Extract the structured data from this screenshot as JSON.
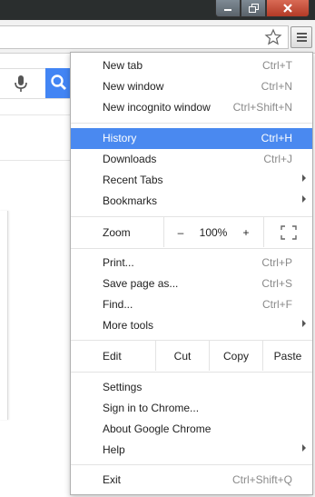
{
  "menu": {
    "items_top": [
      {
        "label": "New tab",
        "shortcut": "Ctrl+T"
      },
      {
        "label": "New window",
        "shortcut": "Ctrl+N"
      },
      {
        "label": "New incognito window",
        "shortcut": "Ctrl+Shift+N"
      }
    ],
    "items_mid": [
      {
        "label": "History",
        "shortcut": "Ctrl+H",
        "highlighted": true
      },
      {
        "label": "Downloads",
        "shortcut": "Ctrl+J"
      },
      {
        "label": "Recent Tabs",
        "submenu": true
      },
      {
        "label": "Bookmarks",
        "submenu": true
      }
    ],
    "zoom": {
      "label": "Zoom",
      "minus": "–",
      "value": "100%",
      "plus": "+"
    },
    "items_tools": [
      {
        "label": "Print...",
        "shortcut": "Ctrl+P"
      },
      {
        "label": "Save page as...",
        "shortcut": "Ctrl+S"
      },
      {
        "label": "Find...",
        "shortcut": "Ctrl+F"
      },
      {
        "label": "More tools",
        "submenu": true
      }
    ],
    "edit": {
      "label": "Edit",
      "cut": "Cut",
      "copy": "Copy",
      "paste": "Paste"
    },
    "items_settings": [
      {
        "label": "Settings"
      },
      {
        "label": "Sign in to Chrome..."
      },
      {
        "label": "About Google Chrome"
      },
      {
        "label": "Help",
        "submenu": true
      }
    ],
    "exit": {
      "label": "Exit",
      "shortcut": "Ctrl+Shift+Q"
    }
  },
  "colors": {
    "highlight": "#4a89f0",
    "search_button": "#4285f4",
    "close_button": "#c7432d"
  },
  "icons": [
    "minimize-icon",
    "maximize-icon",
    "close-icon",
    "star-icon",
    "hamburger-menu-icon",
    "microphone-icon",
    "search-icon",
    "fullscreen-icon",
    "submenu-arrow-icon"
  ]
}
